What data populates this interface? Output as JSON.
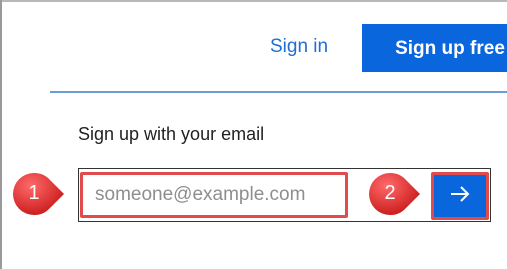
{
  "header": {
    "signin_label": "Sign in",
    "signup_label": "Sign up free"
  },
  "form": {
    "title": "Sign up with your email",
    "email_placeholder": "someone@example.com",
    "submit_icon": "arrow-right-icon"
  },
  "callouts": [
    {
      "number": "1",
      "color": "#e02b2b"
    },
    {
      "number": "2",
      "color": "#e02b2b"
    }
  ],
  "colors": {
    "brand_blue": "#0a66dd",
    "link_blue": "#1f6fd1",
    "highlight_red": "#e14b4b",
    "rule_blue": "#6b9ed6"
  }
}
